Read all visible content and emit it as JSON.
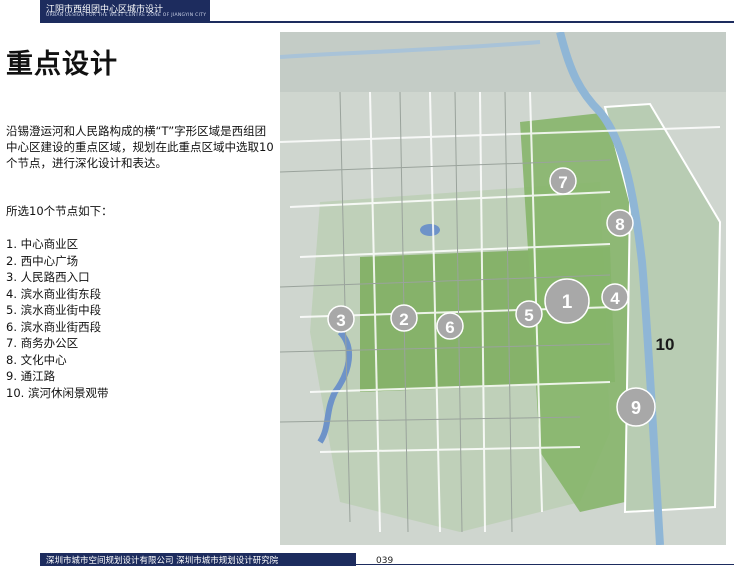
{
  "header": {
    "title": "江阴市西组团中心区城市设计",
    "subtitle": "URBAN DESIGN FOR THE WEST CENTRE ZONE OF JIANGYIN CITY"
  },
  "page_title": "重点设计",
  "intro": "沿锡澄运河和人民路构成的横“T”字形区域是西组团中心区建设的重点区域，规划在此重点区域中选取10个节点，进行深化设计和表达。",
  "list_heading": "所选10个节点如下：",
  "nodes": [
    "1. 中心商业区",
    "2. 西中心广场",
    "3. 人民路西入口",
    "4. 滨水商业街东段",
    "5. 滨水商业街中段",
    "6. 滨水商业街西段",
    "7. 商务办公区",
    "8. 文化中心",
    "9. 通江路",
    "10. 滨河休闲景观带"
  ],
  "map_labels": [
    "1",
    "2",
    "3",
    "4",
    "5",
    "6",
    "7",
    "8",
    "9",
    "10"
  ],
  "footer": "深圳市城市空间规划设计有限公司 深圳市城市规划设计研究院",
  "page_number": "039",
  "colors": {
    "brand": "#1d2c5e",
    "accent": "#ffffff"
  }
}
